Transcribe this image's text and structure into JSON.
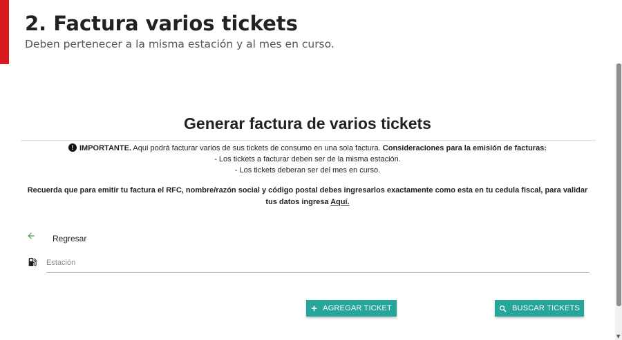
{
  "header": {
    "title": "2. Factura varios tickets",
    "subtitle": "Deben pertenecer a la misma estación y al mes en curso."
  },
  "card": {
    "title": "Generar factura de varios tickets",
    "notice": {
      "important_label": "IMPORTANTE.",
      "important_text": " Aqui podrá facturar varios de sus tickets de consumo en una sola factura. ",
      "considerations_label": "Consideraciones para la emisión de facturas:",
      "line1": "- Los tickets a facturar deben ser de la misma estación.",
      "line2": "- Los tickets deberan ser del mes en curso."
    },
    "reminder": {
      "text": "Recuerda que para emitir tu factura el RFC, nombre/razón social y código postal debes ingresarlos exactamente como esta en tu cedula fiscal, para validar tus datos ingresa ",
      "link": "Aquí."
    },
    "back_label": "Regresar",
    "station_field": {
      "placeholder": "Estación",
      "value": ""
    },
    "add_ticket_button": "AGREGAR TICKET",
    "search_tickets_button": "BUSCAR TICKETS"
  },
  "colors": {
    "accent": "#d71920",
    "button": "#26a69a",
    "back_arrow": "#43a047"
  },
  "icons": {
    "warning": "exclamation-circle-icon",
    "back": "arrow-left-icon",
    "station": "gas-station-icon",
    "add": "plus-icon",
    "search": "search-icon"
  }
}
